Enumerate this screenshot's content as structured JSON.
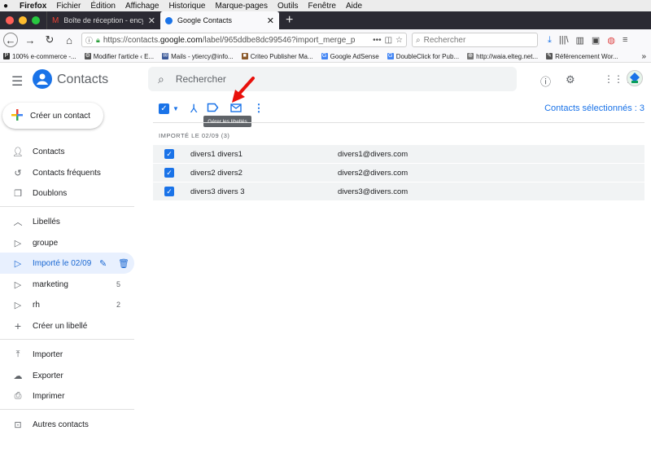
{
  "menubar": {
    "app": "Firefox",
    "items": [
      "Fichier",
      "Édition",
      "Affichage",
      "Historique",
      "Marque-pages",
      "Outils",
      "Fenêtre",
      "Aide"
    ]
  },
  "tabs": [
    {
      "title": "Boîte de réception - encyclope",
      "active": false
    },
    {
      "title": "Google Contacts",
      "active": true
    }
  ],
  "navbar": {
    "url_prefix": "https://contacts.",
    "url_host": "google.com",
    "url_rest": "/label/965ddbe8dc99546?import_merge_p",
    "search_placeholder": "Rechercher"
  },
  "bookmarks": [
    {
      "label": "100% e-commerce -...",
      "color": "#333333",
      "glyph": "P"
    },
    {
      "label": "Modifier l'article ‹ E...",
      "color": "#555555",
      "glyph": "⚙"
    },
    {
      "label": "Mails - ytiercy@info...",
      "color": "#3b5998",
      "glyph": "✉"
    },
    {
      "label": "Criteo Publisher Ma...",
      "color": "#8b5a2b",
      "glyph": "■"
    },
    {
      "label": "Google AdSense",
      "color": "#4285f4",
      "glyph": "G"
    },
    {
      "label": "DoubleClick for Pub...",
      "color": "#4285f4",
      "glyph": "G"
    },
    {
      "label": "http://waia.elteg.net...",
      "color": "#777777",
      "glyph": "⊕"
    },
    {
      "label": "Référencement Wor...",
      "color": "#555555",
      "glyph": "✎"
    }
  ],
  "header": {
    "brand": "Contacts",
    "search_placeholder": "Rechercher"
  },
  "sidebar": {
    "create_label": "Créer un contact",
    "nav": [
      {
        "label": "Contacts",
        "icon": "person-icon"
      },
      {
        "label": "Contacts fréquents",
        "icon": "history-icon"
      },
      {
        "label": "Doublons",
        "icon": "copy-icon"
      }
    ],
    "labels_header": "Libellés",
    "labels": [
      {
        "label": "groupe",
        "count": ""
      },
      {
        "label": "Importé le 02/09",
        "count": ""
      },
      {
        "label": "marketing",
        "count": "5"
      },
      {
        "label": "rh",
        "count": "2"
      }
    ],
    "create_label_label": "Créer un libellé",
    "actions": [
      {
        "label": "Importer",
        "icon": "upload-icon"
      },
      {
        "label": "Exporter",
        "icon": "cloud-download-icon"
      },
      {
        "label": "Imprimer",
        "icon": "print-icon"
      }
    ],
    "other_contacts": "Autres contacts"
  },
  "main": {
    "selected_count": "Contacts sélectionnés : 3",
    "tooltip": "Gérer les libellés",
    "group_header": "IMPORTÉ LE 02/09 (3)",
    "rows": [
      {
        "name": "divers1 divers1",
        "email": "divers1@divers.com"
      },
      {
        "name": "divers2 divers2",
        "email": "divers2@divers.com"
      },
      {
        "name": "divers3 divers 3",
        "email": "divers3@divers.com"
      }
    ]
  },
  "colors": {
    "accent": "#1a73e8",
    "annotation_arrow": "#e8100b"
  }
}
